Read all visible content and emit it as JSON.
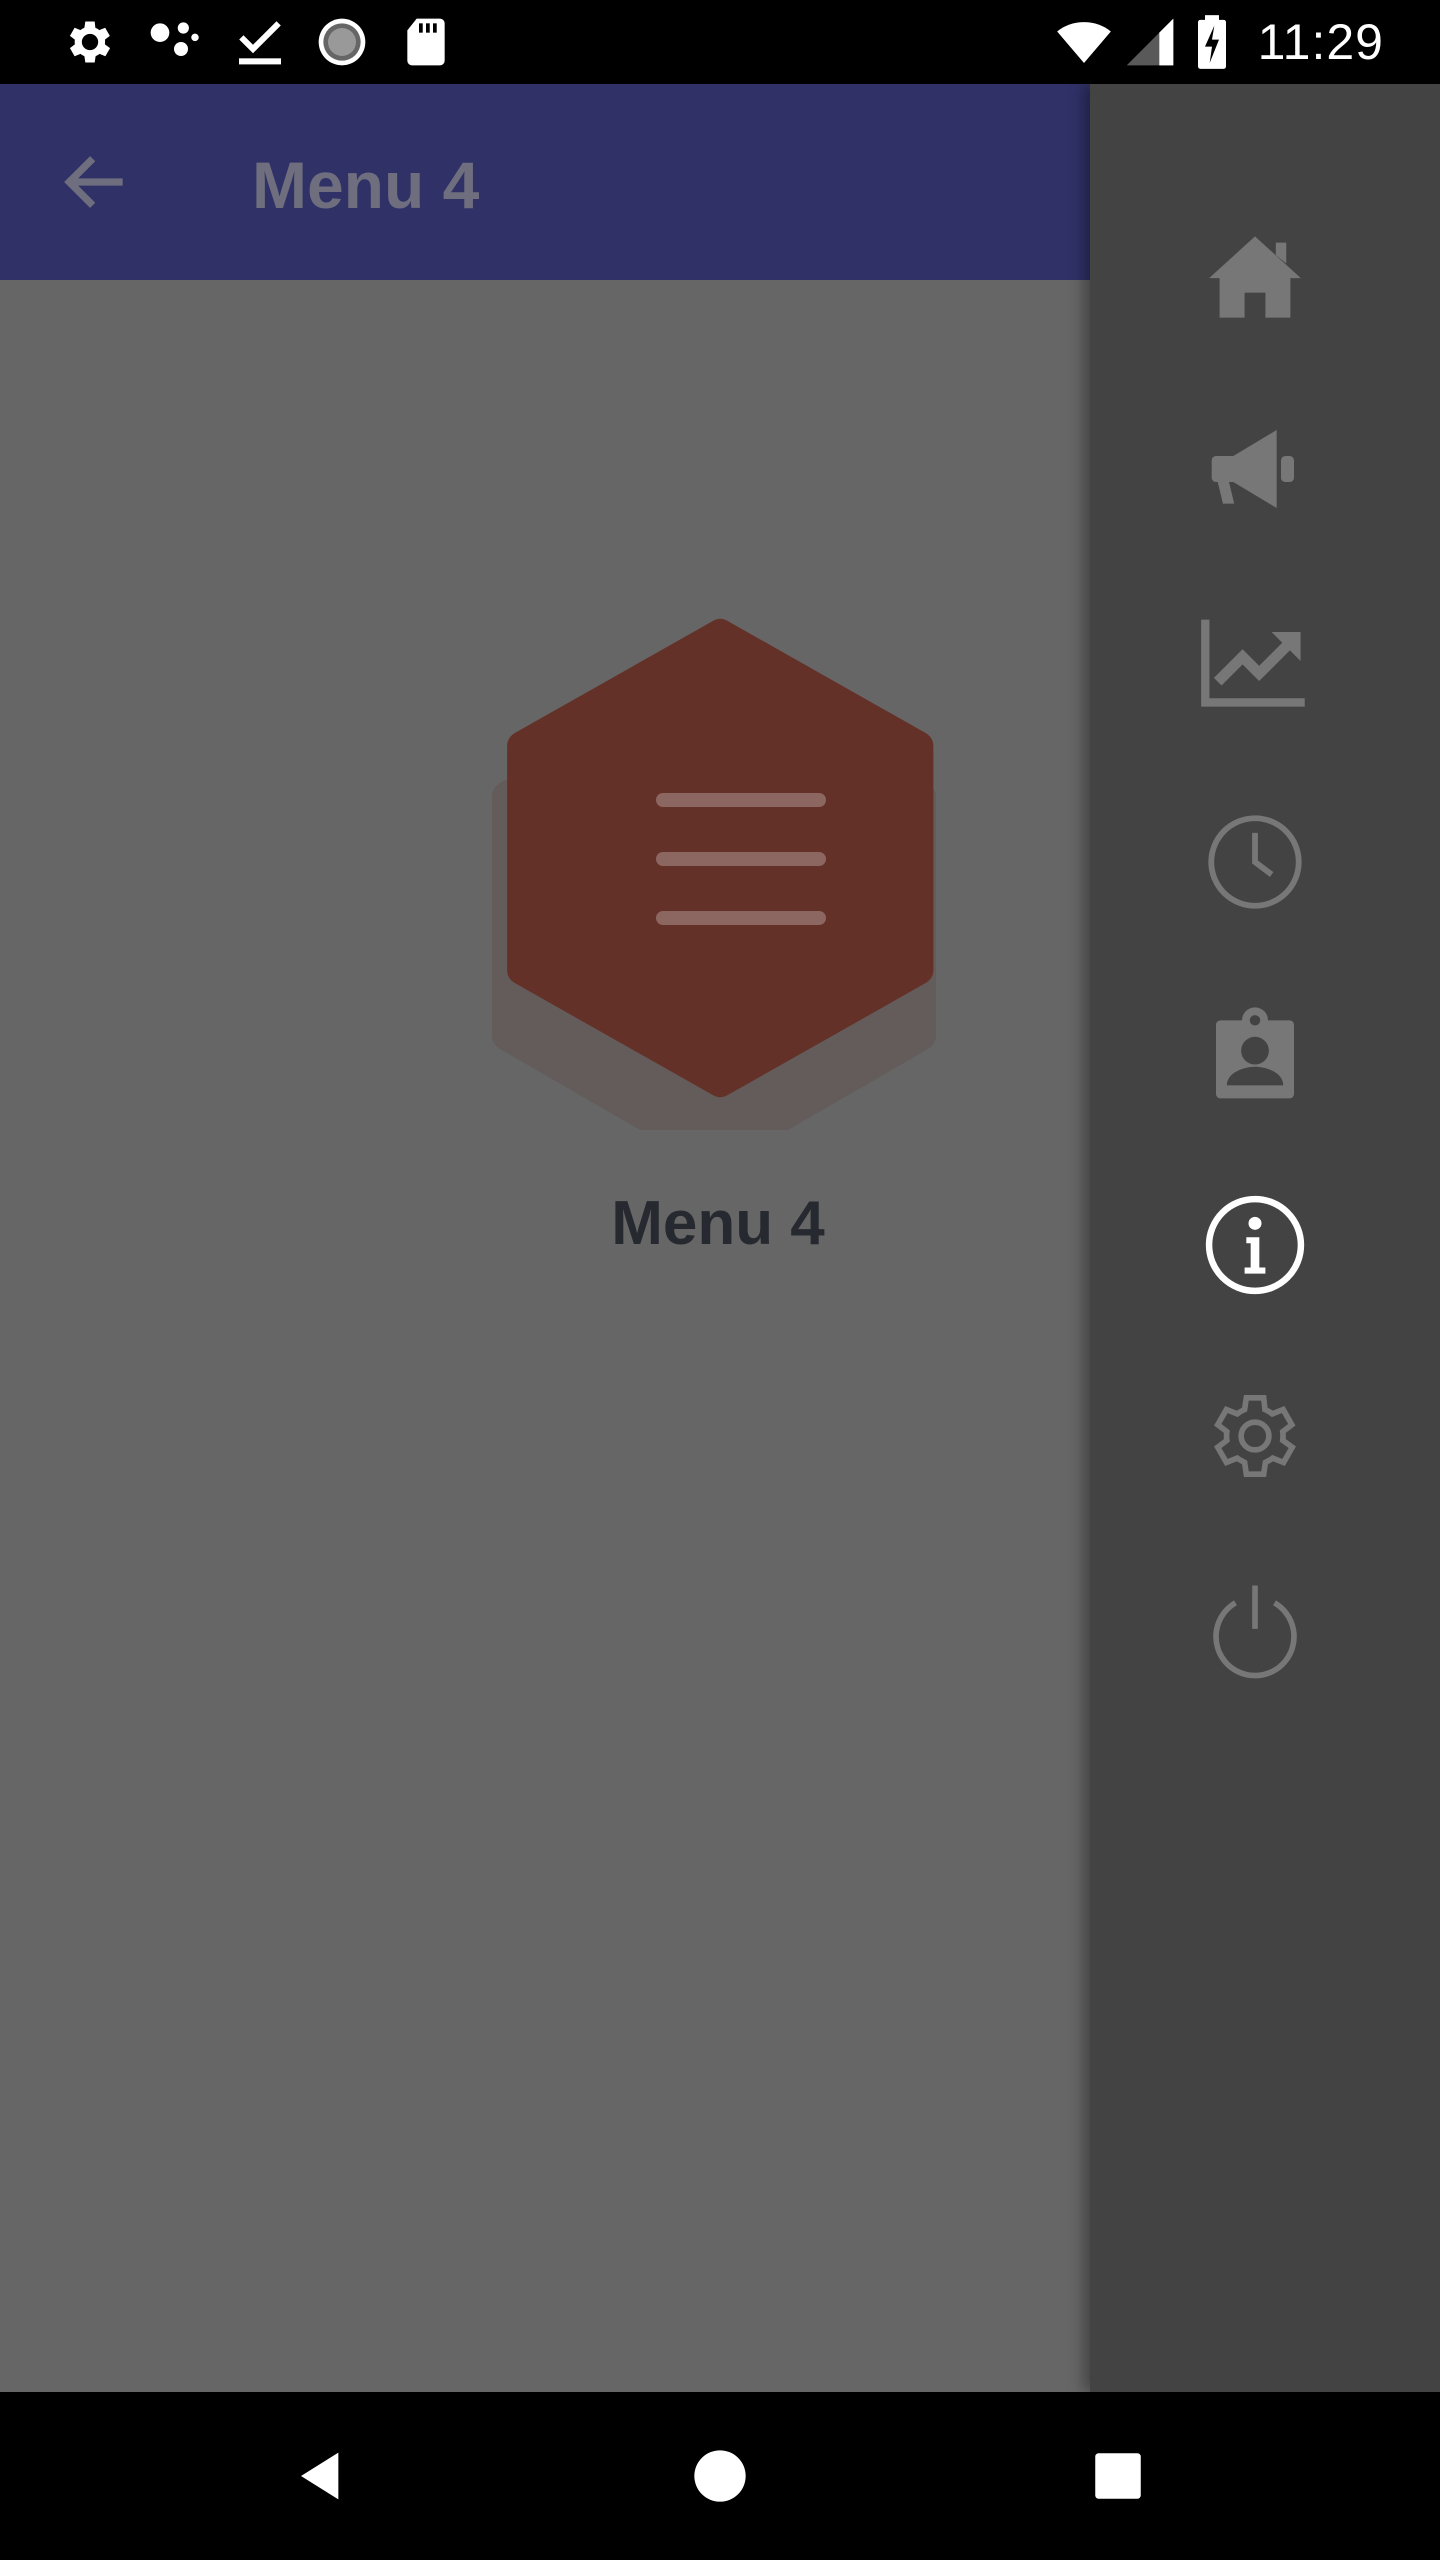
{
  "status_bar": {
    "time": "11:29",
    "icons_left": [
      "settings-icon",
      "connections-icon",
      "download-done-icon",
      "sync-icon",
      "sd-card-icon"
    ],
    "icons_right": [
      "wifi-icon",
      "signal-icon",
      "battery-charging-icon"
    ]
  },
  "app_bar": {
    "title": "Menu 4",
    "back_icon": "arrow-back-icon",
    "background_color": "#303167"
  },
  "main": {
    "hex_icon": "menu-lines-icon",
    "hex_color": "#643128",
    "label": "Menu 4"
  },
  "drawer": {
    "background_color": "#434343",
    "items": [
      {
        "icon": "home-icon",
        "selected": false
      },
      {
        "icon": "megaphone-icon",
        "selected": false
      },
      {
        "icon": "trending-chart-icon",
        "selected": false
      },
      {
        "icon": "clock-icon",
        "selected": false
      },
      {
        "icon": "contact-badge-icon",
        "selected": false
      },
      {
        "icon": "info-icon",
        "selected": true
      },
      {
        "icon": "settings-gear-icon",
        "selected": false
      },
      {
        "icon": "power-icon",
        "selected": false
      }
    ]
  },
  "nav_bar": {
    "buttons": [
      "back-triangle-icon",
      "home-circle-icon",
      "recents-square-icon"
    ]
  }
}
